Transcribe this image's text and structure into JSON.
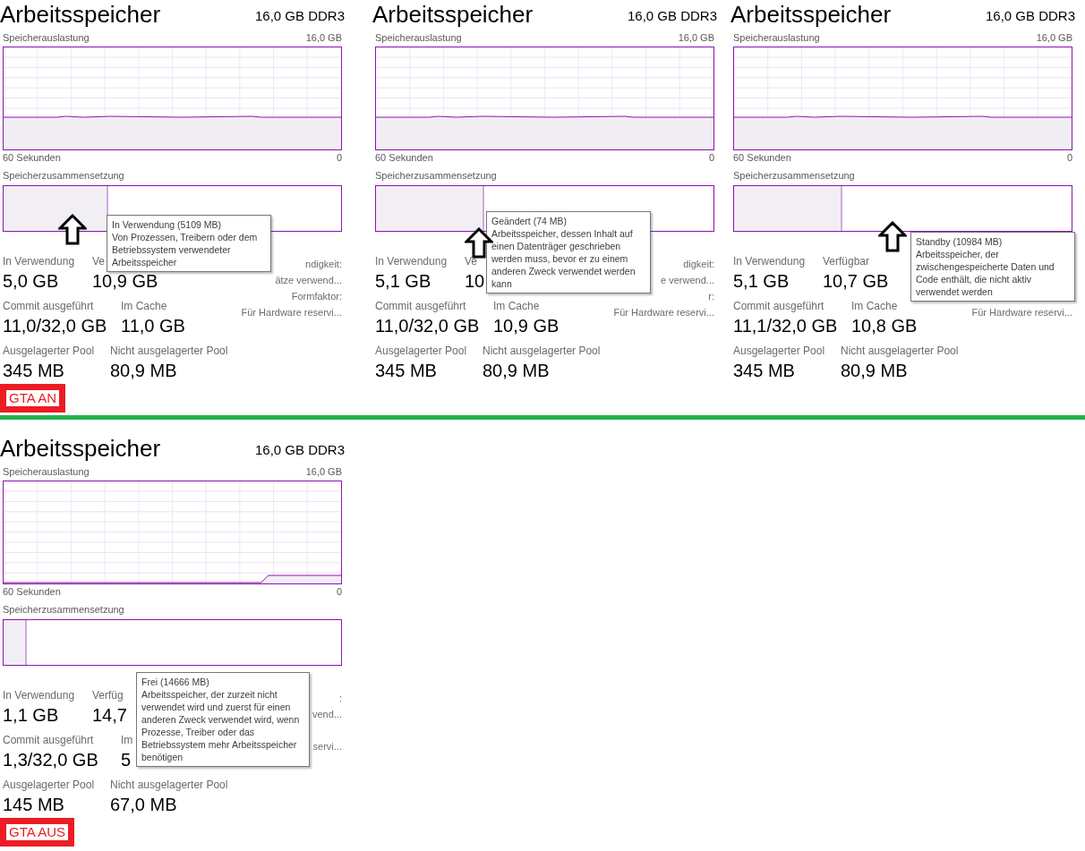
{
  "groups": [
    {
      "tag": "GTA AN",
      "panels": [
        {
          "title": "Arbeitsspeicher",
          "spec": "16,0 GB DDR3",
          "usage_label": "Speicherauslastung",
          "usage_max": "16,0 GB",
          "graph": {
            "kind": "steady"
          },
          "time_label": "60 Sekunden",
          "time_end": "0",
          "composition_label": "Speicherzusammensetzung",
          "composition": {
            "level": 0.31
          },
          "stats": {
            "in_use": {
              "label": "In Verwendung",
              "value": "5,0 GB"
            },
            "available": {
              "label": "Ve",
              "value": "10,9 GB"
            },
            "committed": {
              "label": "Commit ausgeführt",
              "value": "11,0/32,0 GB"
            },
            "cached": {
              "label": "Im Cache",
              "value": "11,0 GB"
            },
            "paged": {
              "label": "Ausgelagerter Pool",
              "value": "345 MB"
            },
            "nonpaged": {
              "label": "Nicht ausgelagerter Pool",
              "value": "80,9 MB"
            }
          },
          "details": {
            "speed": "ndigkeit:",
            "slots": "ätze verwend...",
            "form": "Formfaktor:",
            "reserved": "Für Hardware reservi..."
          },
          "tooltip": {
            "title": "In Verwendung (5109 MB)",
            "text": "Von Prozessen, Treibern oder dem Betriebssystem verwendeter Arbeitsspeicher"
          },
          "arrow": true
        },
        {
          "title": "Arbeitsspeicher",
          "spec": "16,0 GB DDR3",
          "usage_label": "Speicherauslastung",
          "usage_max": "16,0 GB",
          "graph": {
            "kind": "steady"
          },
          "time_label": "60 Sekunden",
          "time_end": "0",
          "composition_label": "Speicherzusammensetzung",
          "composition": {
            "level": 0.32
          },
          "stats": {
            "in_use": {
              "label": "In Verwendung",
              "value": "5,1 GB"
            },
            "available": {
              "label": "Ve",
              "value": "10"
            },
            "committed": {
              "label": "Commit ausgeführt",
              "value": "11,0/32,0 GB"
            },
            "cached": {
              "label": "Im Cache",
              "value": "10,9 GB"
            },
            "paged": {
              "label": "Ausgelagerter Pool",
              "value": "345 MB"
            },
            "nonpaged": {
              "label": "Nicht ausgelagerter Pool",
              "value": "80,9 MB"
            }
          },
          "details": {
            "speed": "digkeit:",
            "slots": "e verwend...",
            "form": "r:",
            "reserved": "Für Hardware reservi..."
          },
          "tooltip": {
            "title": "Geändert (74 MB)",
            "text": "Arbeitsspeicher, dessen Inhalt auf einen Datenträger geschrieben werden muss, bevor er zu einem anderen Zweck verwendet werden kann"
          },
          "arrow": true
        },
        {
          "title": "Arbeitsspeicher",
          "spec": "16,0 GB DDR3",
          "usage_label": "Speicherauslastung",
          "usage_max": "16,0 GB",
          "graph": {
            "kind": "steady"
          },
          "time_label": "60 Sekunden",
          "time_end": "0",
          "composition_label": "Speicherzusammensetzung",
          "composition": {
            "level": 0.32
          },
          "stats": {
            "in_use": {
              "label": "In Verwendung",
              "value": "5,1 GB"
            },
            "available": {
              "label": "Verfügbar",
              "value": "10,7 GB"
            },
            "committed": {
              "label": "Commit ausgeführt",
              "value": "11,1/32,0 GB"
            },
            "cached": {
              "label": "Im Cache",
              "value": "10,8 GB"
            },
            "paged": {
              "label": "Ausgelagerter Pool",
              "value": "345 MB"
            },
            "nonpaged": {
              "label": "Nicht ausgelagerter Pool",
              "value": "80,9 MB"
            }
          },
          "details": {
            "reserved": "Für Hardware reservi..."
          },
          "tooltip": {
            "title": "Standby (10984 MB)",
            "text": "Arbeitsspeicher, der zwischengespeicherte Daten und Code enthält, die nicht aktiv verwendet werden"
          },
          "arrow": true
        }
      ]
    },
    {
      "tag": "GTA AUS",
      "panels": [
        {
          "title": "Arbeitsspeicher",
          "spec": "16,0 GB DDR3",
          "usage_label": "Speicherauslastung",
          "usage_max": "16,0 GB",
          "graph": {
            "kind": "rising_end"
          },
          "time_label": "60 Sekunden",
          "time_end": "0",
          "composition_label": "Speicherzusammensetzung",
          "composition": {
            "level": 0.07
          },
          "stats": {
            "in_use": {
              "label": "In Verwendung",
              "value": "1,1 GB"
            },
            "available": {
              "label": "Verfüg",
              "value": "14,7"
            },
            "committed": {
              "label": "Commit ausgeführt",
              "value": "1,3/32,0 GB"
            },
            "cached": {
              "label": "Im",
              "value": "5"
            },
            "paged": {
              "label": "Ausgelagerter Pool",
              "value": "145 MB"
            },
            "nonpaged": {
              "label": "Nicht ausgelagerter Pool",
              "value": "67,0 MB"
            }
          },
          "details": {
            "speed": ":",
            "slots": "vend...",
            "reserved": "servi..."
          },
          "tooltip": {
            "title": "Frei (14666 MB)",
            "text": "Arbeitsspeicher, der zurzeit nicht verwendet wird und zuerst für einen anderen Zweck verwendet wird, wenn Prozesse, Treiber oder das Betriebssystem mehr Arbeitsspeicher benötigen"
          },
          "arrow": false
        }
      ]
    }
  ]
}
